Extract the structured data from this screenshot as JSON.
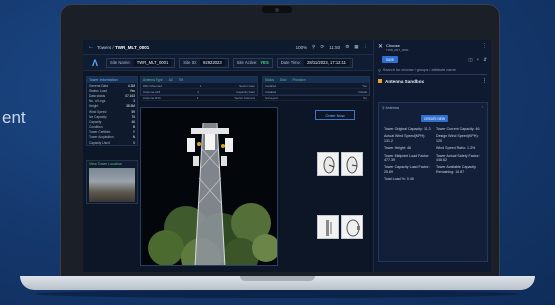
{
  "side_text": "ent",
  "app": {
    "topbar": {
      "back_label": "←",
      "crumb_root": "Towers /",
      "crumb_current": "TWR_MLT_0001",
      "zoom": "100%",
      "time": "11:50",
      "right_icons": [
        "search-icon",
        "refresh-icon",
        "settings-icon",
        "grid-icon",
        "menu-icon"
      ]
    },
    "infobar": {
      "site_name_label": "Site Name:",
      "site_name_value": "TWR_MLT_0001",
      "site_id_label": "Site ID:",
      "site_id_value": "92922023",
      "site_active_label": "Site Active:",
      "site_active_value": "YES",
      "date_time_label": "Date Time:",
      "date_time_value": "28/11/2023, 17:12:11"
    },
    "left_panel": {
      "title": "Tower Information",
      "rows": [
        {
          "k": "General Data",
          "v": "4.3M"
        },
        {
          "k": "Station Load",
          "v": "Yes"
        },
        {
          "k": "Data status",
          "v": "07.163"
        },
        {
          "k": "No. of Legs",
          "v": "3"
        },
        {
          "k": "Height",
          "v": "38.5M"
        },
        {
          "k": "Wind Speed",
          "v": "59"
        },
        {
          "k": "Ice Capacity",
          "v": "76"
        },
        {
          "k": "Capacity",
          "v": "46"
        },
        {
          "k": "Condition",
          "v": "B"
        },
        {
          "k": "Tower Certified",
          "v": "Y"
        },
        {
          "k": "Tower Acquisition",
          "v": "N"
        },
        {
          "k": "Capacity Used",
          "v": "0"
        }
      ]
    },
    "site_location_title": "View Tower Location",
    "table_left": {
      "headers": [
        "Antenna Type",
        "AZ",
        "Tilt"
      ],
      "rows": [
        {
          "a": "RRU Mounted",
          "b": "1",
          "c": "Sector Gain"
        },
        {
          "a": "Antenna A18",
          "b": "2",
          "c": "Capacity Gain"
        },
        {
          "a": "Antenna R34",
          "b": "3",
          "c": "Sector Antenna"
        }
      ]
    },
    "table_right": {
      "headers": [
        "Status",
        "Dish",
        "Provision"
      ],
      "rows": [
        {
          "a": "Installed",
          "b": "Yes"
        },
        {
          "a": "Installed",
          "b": "Partial"
        },
        {
          "a": "Surveyed",
          "b": "No"
        }
      ]
    },
    "order_button": "Order Now"
  },
  "right_panel": {
    "close_label": "✕",
    "choose_title": "Choose",
    "choose_sub": "TWR_MLT_0001",
    "pill": "SAVE",
    "search_placeholder": "Search for choose / groups / attribute name",
    "sandbox_title": "Antenna Sandbox",
    "card_title": "Antenna",
    "create_button": "CREATE NEW",
    "stats": [
      {
        "label": "Tower Original Capacity:",
        "value": "11.3"
      },
      {
        "label": "Tower Current Capacity:",
        "value": "46"
      },
      {
        "label": "Actual Wind Speed(KPH):",
        "value": "131.2"
      },
      {
        "label": "Design Wind Speed(KPH):",
        "value": "120"
      },
      {
        "label": "Tower Height:",
        "value": "46"
      },
      {
        "label": "Wind Speed Ratio:",
        "value": "1.3%"
      },
      {
        "label": "Tower Midpoint Load Factor:",
        "value": "477.39"
      },
      {
        "label": "Tower Actual Safety Factor:",
        "value": "448.82"
      },
      {
        "label": "Tower Capacity Load Factor:",
        "value": "25.69"
      },
      {
        "label": "Tower Available Capacity Remaining:",
        "value": "10.87"
      },
      {
        "label": "Total Load %:",
        "value": "0.45"
      }
    ]
  }
}
